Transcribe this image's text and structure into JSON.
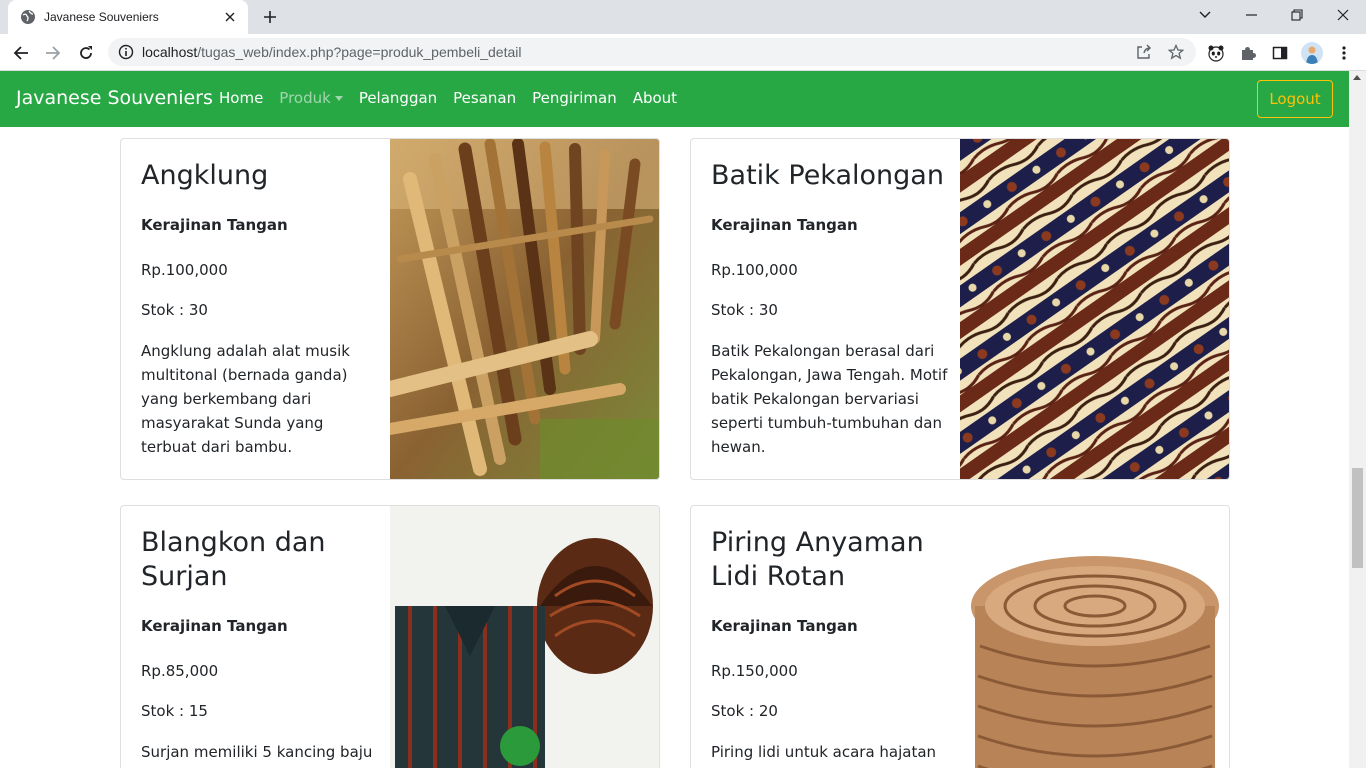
{
  "browser": {
    "tab_title": "Javanese Souveniers",
    "url_host": "localhost",
    "url_path": "/tugas_web/index.php?page=produk_pembeli_detail"
  },
  "navbar": {
    "brand": "Javanese Souveniers",
    "links": [
      "Home",
      "Produk",
      "Pelanggan",
      "Pesanan",
      "Pengiriman",
      "About"
    ],
    "logout": "Logout",
    "colors": {
      "bg": "#28a745",
      "logout": "#ffc107"
    }
  },
  "products": [
    {
      "name": "Angklung",
      "category": "Kerajinan Tangan",
      "price": "Rp.100,000",
      "stock": "Stok : 30",
      "description": "Angklung adalah alat musik multitonal (bernada ganda) yang berkembang dari masyarakat Sunda yang terbuat dari bambu."
    },
    {
      "name": "Batik Pekalongan",
      "category": "Kerajinan Tangan",
      "price": "Rp.100,000",
      "stock": "Stok : 30",
      "description": "Batik Pekalongan berasal dari Pekalongan, Jawa Tengah. Motif batik Pekalongan bervariasi seperti tumbuh-tumbuhan dan hewan."
    },
    {
      "name": "Blangkon dan Surjan",
      "category": "Kerajinan Tangan",
      "price": "Rp.85,000",
      "stock": "Stok : 15",
      "description": "Surjan memiliki 5 kancing baju"
    },
    {
      "name": "Piring Anyaman Lidi Rotan",
      "category": "Kerajinan Tangan",
      "price": "Rp.150,000",
      "stock": "Stok : 20",
      "description": "Piring lidi untuk acara hajatan"
    }
  ]
}
